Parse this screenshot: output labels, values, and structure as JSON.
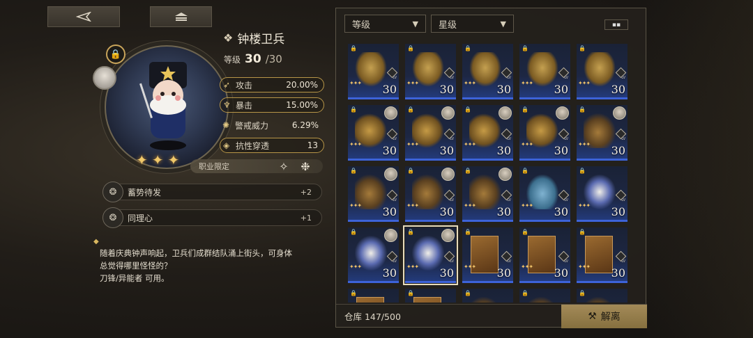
{
  "nav": {
    "back_icon": "back-arrow-icon",
    "home_icon": "home-icon"
  },
  "character": {
    "name": "钟楼卫兵",
    "level_label": "等级",
    "level_current": "30",
    "level_max": "/30",
    "stars": 3
  },
  "stats": [
    {
      "name": "攻击",
      "value": "20.00%",
      "icon": "sword-icon",
      "boxed": true
    },
    {
      "name": "暴击",
      "value": "15.00%",
      "icon": "crit-icon",
      "boxed": true
    },
    {
      "name": "警戒威力",
      "value": "6.29%",
      "icon": "alert-icon",
      "boxed": false
    },
    {
      "name": "抗性穿透",
      "value": "13",
      "icon": "pierce-icon",
      "boxed": true
    }
  ],
  "class_limit": {
    "label": "职业限定"
  },
  "skills": [
    {
      "name": "蓄势待发",
      "level": "+2"
    },
    {
      "name": "同理心",
      "level": "+1"
    }
  ],
  "description": {
    "line1": "随着庆典钟声响起，卫兵们成群结队涌上街头，可身体",
    "line2": "总觉得哪里怪怪的？",
    "line3": "刀锋/异能者 可用。"
  },
  "filters": {
    "sort_by": "等级",
    "rarity": "星级"
  },
  "inventory": {
    "items": [
      {
        "art": "lion",
        "level": "30",
        "lv_tag": "LV",
        "avatar": false,
        "selected": false,
        "stars": "✦✦✦"
      },
      {
        "art": "lion",
        "level": "30",
        "lv_tag": "LV",
        "avatar": false,
        "selected": false,
        "stars": "✦✦✦"
      },
      {
        "art": "lion",
        "level": "30",
        "lv_tag": "LV",
        "avatar": false,
        "selected": false,
        "stars": "✦✦✦"
      },
      {
        "art": "lion",
        "level": "30",
        "lv_tag": "LV",
        "avatar": false,
        "selected": false,
        "stars": "✦✦✦"
      },
      {
        "art": "lion",
        "level": "30",
        "lv_tag": "LV",
        "avatar": false,
        "selected": false,
        "stars": "✦✦✦"
      },
      {
        "art": "dragon",
        "level": "30",
        "lv_tag": "LV",
        "avatar": true,
        "selected": false,
        "stars": "✦✦✦"
      },
      {
        "art": "dragon",
        "level": "30",
        "lv_tag": "LV",
        "avatar": true,
        "selected": false,
        "stars": "✦✦✦"
      },
      {
        "art": "dragon",
        "level": "30",
        "lv_tag": "LV",
        "avatar": true,
        "selected": false,
        "stars": "✦✦✦"
      },
      {
        "art": "dragon",
        "level": "30",
        "lv_tag": "LV",
        "avatar": true,
        "selected": false,
        "stars": "✦✦✦"
      },
      {
        "art": "wing",
        "level": "30",
        "lv_tag": "LV",
        "avatar": true,
        "selected": false,
        "stars": "✦✦✦"
      },
      {
        "art": "wing",
        "level": "30",
        "lv_tag": "LV",
        "avatar": true,
        "selected": false,
        "stars": "✦✦✦"
      },
      {
        "art": "wing",
        "level": "30",
        "lv_tag": "LV",
        "avatar": true,
        "selected": false,
        "stars": "✦✦✦"
      },
      {
        "art": "wing",
        "level": "30",
        "lv_tag": "LV",
        "avatar": true,
        "selected": false,
        "stars": "✦✦✦"
      },
      {
        "art": "blue",
        "level": "30",
        "lv_tag": "LV",
        "avatar": false,
        "selected": false,
        "stars": "✦✦✦"
      },
      {
        "art": "soldier",
        "level": "30",
        "lv_tag": "LV",
        "avatar": false,
        "selected": false,
        "stars": "✦✦✦"
      },
      {
        "art": "soldier",
        "level": "30",
        "lv_tag": "LV",
        "avatar": true,
        "selected": false,
        "stars": "✦✦✦"
      },
      {
        "art": "soldier",
        "level": "30",
        "lv_tag": "LV",
        "avatar": true,
        "selected": true,
        "stars": "✦✦✦"
      },
      {
        "art": "card",
        "level": "30",
        "lv_tag": "LV",
        "avatar": false,
        "selected": false,
        "stars": "✦✦✦"
      },
      {
        "art": "card",
        "level": "30",
        "lv_tag": "LV",
        "avatar": false,
        "selected": false,
        "stars": "✦✦✦"
      },
      {
        "art": "card",
        "level": "30",
        "lv_tag": "LV",
        "avatar": false,
        "selected": false,
        "stars": "✦✦✦"
      },
      {
        "art": "card",
        "level": "",
        "lv_tag": "",
        "avatar": false,
        "selected": false,
        "stars": ""
      },
      {
        "art": "card",
        "level": "",
        "lv_tag": "",
        "avatar": false,
        "selected": false,
        "stars": ""
      },
      {
        "art": "wing",
        "level": "",
        "lv_tag": "",
        "avatar": false,
        "selected": false,
        "stars": ""
      },
      {
        "art": "wing",
        "level": "",
        "lv_tag": "",
        "avatar": false,
        "selected": false,
        "stars": ""
      },
      {
        "art": "wing",
        "level": "",
        "lv_tag": "",
        "avatar": false,
        "selected": false,
        "stars": ""
      }
    ]
  },
  "storage": {
    "label": "仓库 147/500"
  },
  "dismantle": {
    "label": "解离"
  },
  "colors": {
    "accent_gold": "#b89648",
    "rarity_blue": "#3d63d8",
    "button_gold": "#a38a58"
  }
}
